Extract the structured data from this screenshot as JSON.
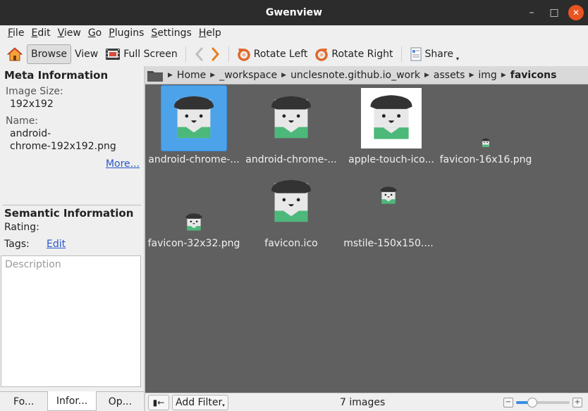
{
  "window": {
    "title": "Gwenview",
    "minimize_glyph": "–",
    "maximize_glyph": "□",
    "close_glyph": "✕"
  },
  "menu": [
    {
      "m": "F",
      "rest": "ile"
    },
    {
      "m": "E",
      "rest": "dit"
    },
    {
      "m": "V",
      "rest": "iew"
    },
    {
      "m": "G",
      "rest": "o"
    },
    {
      "m": "P",
      "rest": "lugins"
    },
    {
      "m": "S",
      "rest": "ettings"
    },
    {
      "m": "H",
      "rest": "elp"
    }
  ],
  "toolbar": {
    "browse": "Browse",
    "view": "View",
    "full_screen": "Full Screen",
    "rotate_left": "Rotate Left",
    "rotate_right": "Rotate Right",
    "share": "Share"
  },
  "sidebar": {
    "meta_title": "Meta Information",
    "image_size_label": "Image Size:",
    "image_size_value": "192x192",
    "name_label": "Name:",
    "name_line1": "android-",
    "name_line2": "chrome-192x192.png",
    "more_link": "More...",
    "semantic_title": "Semantic Information",
    "rating_label": "Rating:",
    "tags_label": "Tags:",
    "tags_edit": "Edit",
    "description_placeholder": "Description",
    "tabs": [
      "Fo...",
      "Infor...",
      "Op..."
    ]
  },
  "breadcrumb": [
    "Home",
    "_workspace",
    "unclesnote.github.io_work",
    "assets",
    "img",
    "favicons"
  ],
  "thumbnails": [
    {
      "caption": "android-chrome-...",
      "icon": "pirate-face-icon"
    },
    {
      "caption": "android-chrome-...",
      "icon": "pirate-face-icon"
    },
    {
      "caption": "apple-touch-ico...",
      "icon": "pirate-face-icon"
    },
    {
      "caption": "favicon-16x16.png",
      "icon": "pirate-face-icon"
    },
    {
      "caption": "favicon-32x32.png",
      "icon": "pirate-face-icon"
    },
    {
      "caption": "favicon.ico",
      "icon": "pirate-face-icon"
    },
    {
      "caption": "mstile-150x150....",
      "icon": "pirate-face-icon"
    }
  ],
  "status": {
    "add_filter": "Add Filter",
    "image_count": "7 images",
    "zoom_fraction": 0.3
  },
  "colors": {
    "selection": "#4da3e9",
    "link": "#2a57c8",
    "close_button": "#e95420",
    "thumbnail_bg": "#606060"
  }
}
